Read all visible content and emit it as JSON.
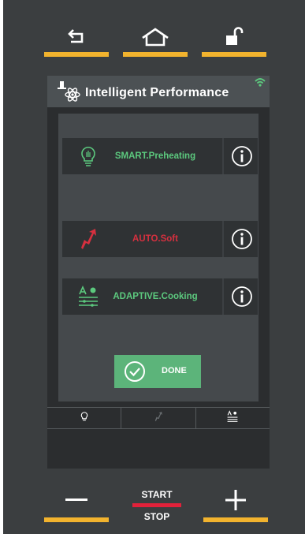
{
  "header": {
    "title": "Intelligent Performance"
  },
  "features": [
    {
      "label": "SMART.Preheating",
      "color": "#5cc97e",
      "icon": "bulb-icon"
    },
    {
      "label": "AUTO.Soft",
      "color": "#d6303f",
      "icon": "soft-arrow-icon"
    },
    {
      "label": "ADAPTIVE.Cooking",
      "color": "#5cc97e",
      "icon": "adaptive-icon"
    }
  ],
  "done_button": {
    "label": "DONE"
  },
  "start_stop": {
    "start": "START",
    "stop": "STOP"
  },
  "colors": {
    "accent_bar": "#f2b32e",
    "green": "#5cc97e",
    "red": "#d6303f",
    "done_bg": "#5cb47a"
  }
}
